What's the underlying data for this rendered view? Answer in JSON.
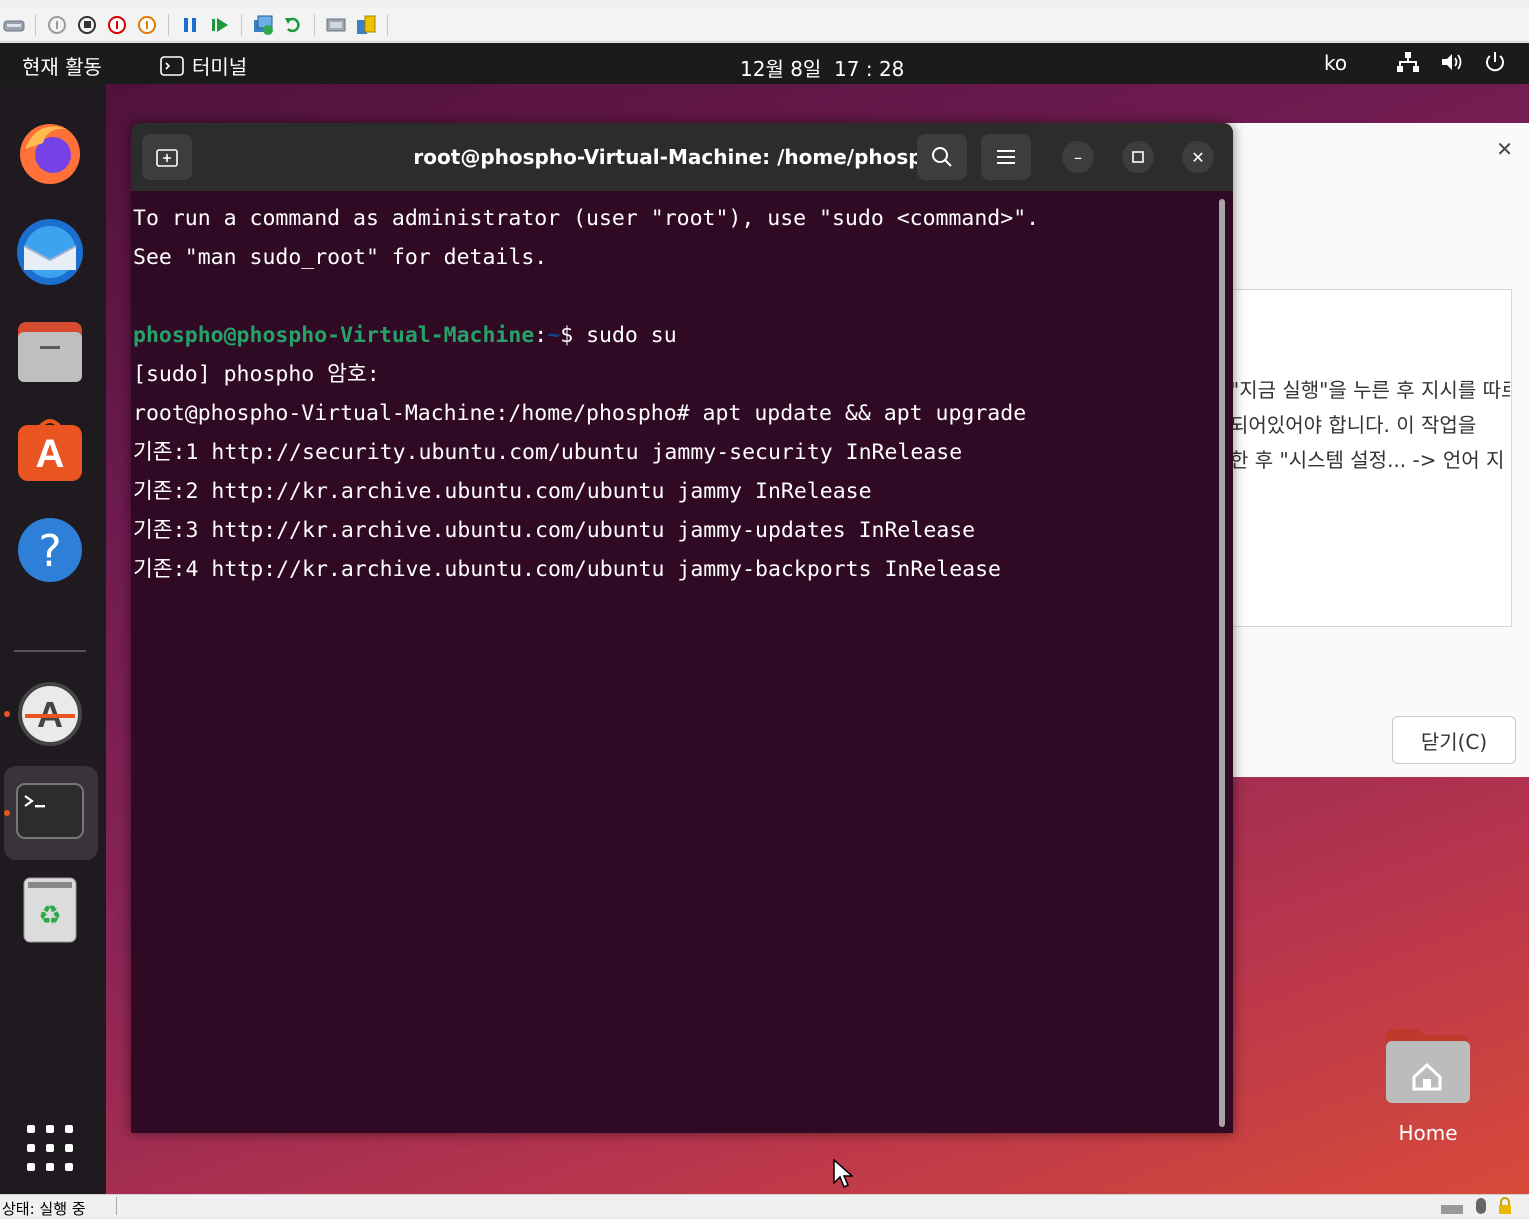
{
  "host": {
    "status_text": "상태: 실행 중",
    "toolbar": [
      "ctrl-alt-del-icon",
      "start-icon",
      "turn-off-icon",
      "shutdown-icon",
      "save-icon",
      "pause-icon",
      "reset-icon",
      "checkpoint-icon",
      "revert-icon",
      "enhanced-session-icon",
      "share-icon"
    ]
  },
  "topbar": {
    "activities": "현재 활동",
    "app_name": "터미널",
    "clock": "12월 8일  17 : 28",
    "lang": "ko"
  },
  "dialog": {
    "lines": [
      "\"지금 실행\"을 누른 후 지시를 따르",
      "되어있어야 합니다. 이 작업을",
      "한 후 \"시스템 설정... -> 언어 지"
    ],
    "close_button": "닫기(C)"
  },
  "terminal": {
    "title": "root@phospho-Virtual-Machine: /home/phospho",
    "lines": [
      "To run a command as administrator (user \"root\"), use \"sudo <command>\".",
      "See \"man sudo_root\" for details.",
      ""
    ],
    "prompt_user": "phospho@phospho-Virtual-Machine",
    "prompt_colon": ":",
    "prompt_path": "~",
    "prompt_cmd": "$ sudo su",
    "output": [
      "[sudo] phospho 암호:",
      "root@phospho-Virtual-Machine:/home/phospho# apt update && apt upgrade",
      "기존:1 http://security.ubuntu.com/ubuntu jammy-security InRelease",
      "기존:2 http://kr.archive.ubuntu.com/ubuntu jammy InRelease",
      "기존:3 http://kr.archive.ubuntu.com/ubuntu jammy-updates InRelease",
      "기존:4 http://kr.archive.ubuntu.com/ubuntu jammy-backports InRelease"
    ]
  },
  "desktop": {
    "home_label": "Home"
  },
  "colors": {
    "terminal_bg": "#300a24",
    "prompt_user": "#26a269",
    "prompt_path": "#12488b",
    "ubuntu_orange": "#e95420"
  }
}
